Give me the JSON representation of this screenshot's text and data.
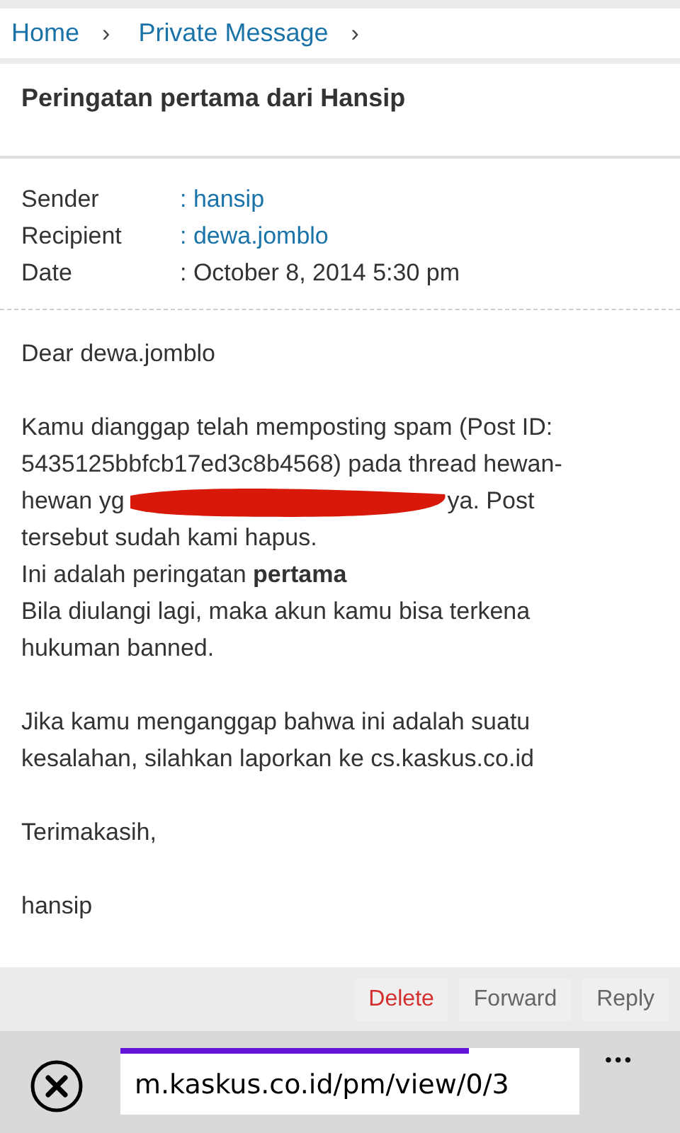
{
  "breadcrumb": [
    {
      "label": "Home",
      "separator": "›"
    },
    {
      "label": "Private Message",
      "separator": "›"
    }
  ],
  "title": "Peringatan pertama dari Hansip",
  "meta": [
    {
      "label": "Sender",
      "value": ": hansip",
      "link": true
    },
    {
      "label": "Recipient",
      "value": ": dewa.jomblo",
      "link": true
    },
    {
      "label": "Date",
      "value": ": October 8, 2014 5:30 pm",
      "link": false
    }
  ],
  "paragraphs": [
    {
      "lines": [
        {
          "kind": "text",
          "text": "Dear dewa.jomblo"
        }
      ]
    },
    {
      "lines": [
        {
          "kind": "text",
          "text": "Kamu dianggap telah memposting spam (Post ID:"
        },
        {
          "kind": "text",
          "text": "5435125bbfcb17ed3c8b4568) pada thread hewan-"
        },
        {
          "kind": "redacted",
          "before": "hewan yg",
          "after": "ya. Post"
        },
        {
          "kind": "text",
          "text": "tersebut sudah kami hapus."
        },
        {
          "kind": "text",
          "text": "Ini adalah peringatan **pertama**"
        },
        {
          "kind": "text",
          "text": "Bila diulangi lagi, maka akun kamu bisa terkena"
        },
        {
          "kind": "text",
          "text": "hukuman banned."
        }
      ]
    },
    {
      "lines": [
        {
          "kind": "text",
          "text": "Jika kamu menganggap bahwa ini adalah suatu"
        },
        {
          "kind": "text",
          "text": "kesalahan, silahkan laporkan ke cs.kaskus.co.id"
        }
      ]
    },
    {
      "lines": [
        {
          "kind": "text",
          "text": "Terimakasih,"
        }
      ]
    },
    {
      "lines": [
        {
          "kind": "text",
          "text": "hansip"
        }
      ]
    }
  ],
  "actions": [
    {
      "label": "Delete",
      "kind": "danger"
    },
    {
      "label": "Forward",
      "kind": "normal"
    },
    {
      "label": "Reply",
      "kind": "normal"
    }
  ],
  "browser": {
    "url": "m.kaskus.co.id/pm/view/0/3",
    "level": 0.76,
    "more": "•••"
  }
}
